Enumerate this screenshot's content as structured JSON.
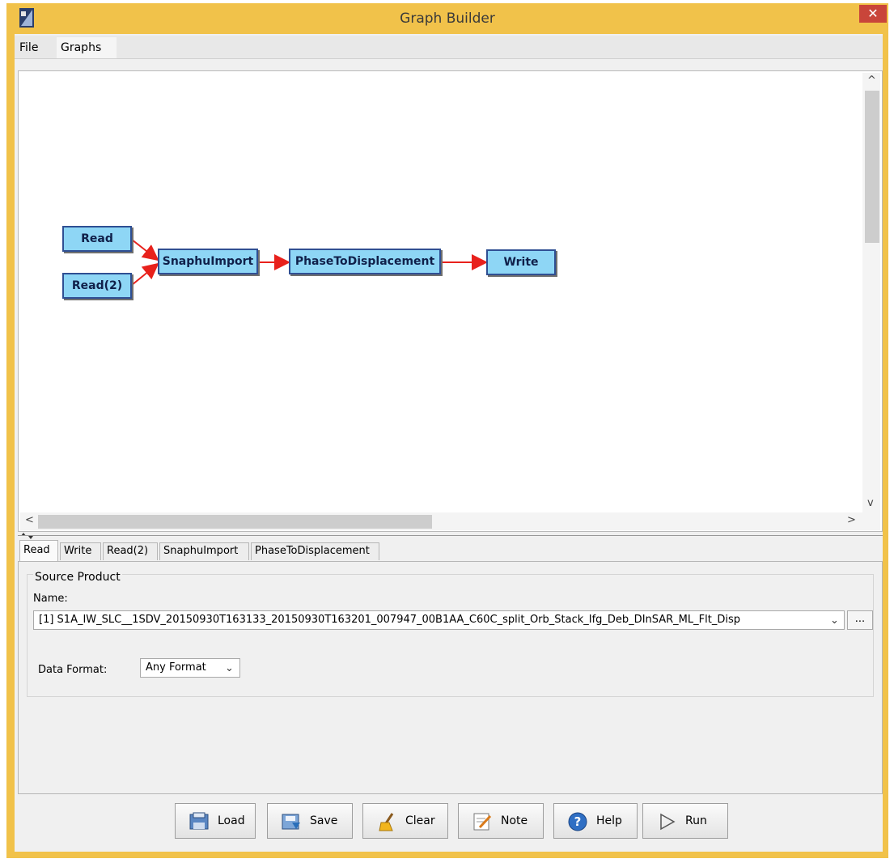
{
  "window": {
    "title": "Graph Builder",
    "close_glyph": "✕"
  },
  "menubar": {
    "items": [
      "File",
      "Graphs"
    ]
  },
  "graph": {
    "nodes": [
      "Read",
      "Read(2)",
      "SnaphuImport",
      "PhaseToDisplacement",
      "Write"
    ],
    "edge_color": "#e8211c",
    "node_color": "#8ed6f5"
  },
  "scroll": {
    "up": "^",
    "down": "v",
    "left": "<",
    "right": ">"
  },
  "tabs": [
    "Read",
    "Write",
    "Read(2)",
    "SnaphuImport",
    "PhaseToDisplacement"
  ],
  "source_product": {
    "group_title": "Source Product",
    "name_label": "Name:",
    "name_value": "[1] S1A_IW_SLC__1SDV_20150930T163133_20150930T163201_007947_00B1AA_C60C_split_Orb_Stack_Ifg_Deb_DInSAR_ML_Flt_Disp",
    "browse_label": "...",
    "format_label": "Data Format:",
    "format_value": "Any Format"
  },
  "buttons": [
    "Load",
    "Save",
    "Clear",
    "Note",
    "Help",
    "Run"
  ]
}
